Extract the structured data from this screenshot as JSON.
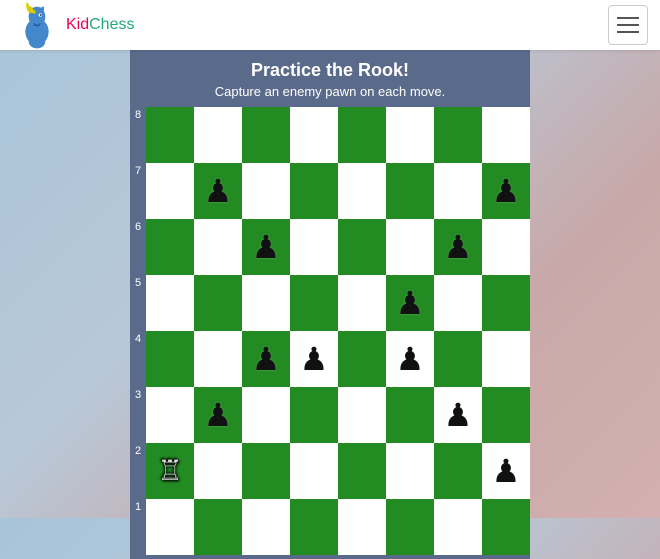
{
  "header": {
    "logo_kid": "Kid",
    "logo_chess": "Chess",
    "hamburger_label": "Menu"
  },
  "banner": {
    "title": "Practice the Rook!",
    "subtitle": "Capture an enemy pawn on each move."
  },
  "board": {
    "ranks": [
      "8",
      "7",
      "6",
      "5",
      "4",
      "3",
      "2",
      "1"
    ],
    "accent_color": "#5a6a8a",
    "board_dark_color": "#228B22",
    "board_light_color": "#ffffff"
  },
  "pieces": {
    "black_pawn": "♟",
    "white_rook": "♖"
  }
}
